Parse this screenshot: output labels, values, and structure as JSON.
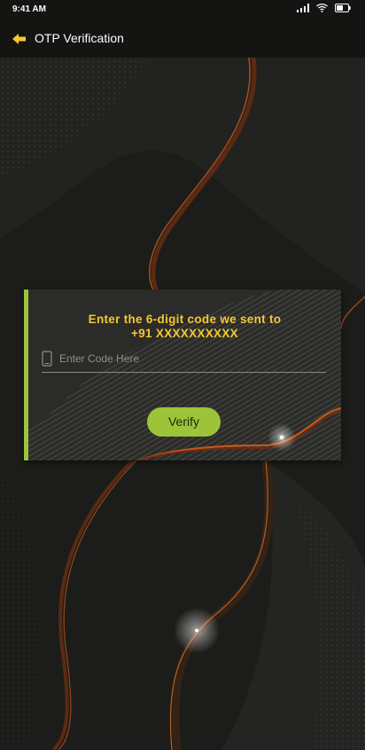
{
  "status_bar": {
    "time": "9:41 AM"
  },
  "app_bar": {
    "title": "OTP Verification"
  },
  "otp_card": {
    "message_line1": "Enter the 6-digit code we sent to",
    "message_line2": "+91 XXXXXXXXXX",
    "code_placeholder": "Enter Code Here",
    "verify_label": "Verify"
  },
  "colors": {
    "accent_green": "#9cc43a",
    "message_yellow": "#f5c830",
    "back_arrow_yellow": "#f5c830",
    "background": "#1c1c1a"
  },
  "icons": [
    "signal-icon",
    "wifi-icon",
    "battery-icon",
    "back-arrow-icon",
    "phone-icon"
  ]
}
